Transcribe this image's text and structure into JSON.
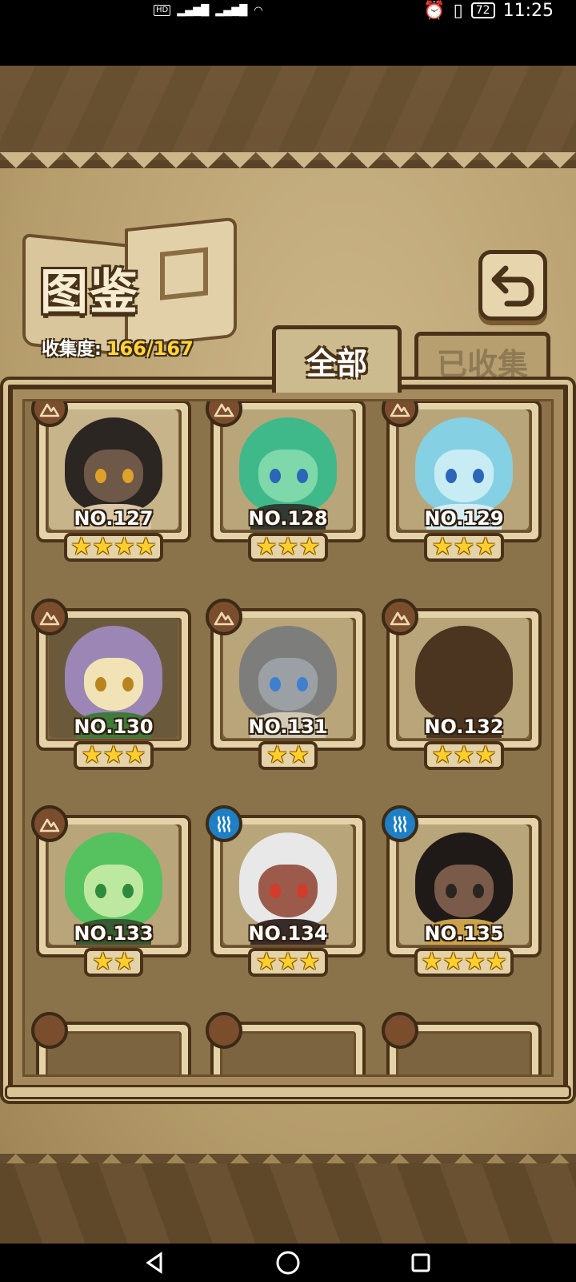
{
  "status_bar": {
    "left_indicators": "HD 2  4G  4G",
    "battery": "72",
    "time": "11:25"
  },
  "header": {
    "title": "图鉴",
    "collection_label": "收集度:",
    "collection_value": "166/167"
  },
  "tabs": [
    {
      "label": "全部",
      "selected": true
    },
    {
      "label": "已收集",
      "selected": false
    }
  ],
  "cards": [
    {
      "number": "NO.127",
      "stars": "★★★★",
      "element": "earth",
      "hair": "#2b2622",
      "skin": "#6e5847",
      "eye": "#e0a12a",
      "cloth": "#d9c7a7",
      "bg": "#c8b48a"
    },
    {
      "number": "NO.128",
      "stars": "★★★",
      "element": "earth",
      "hair": "#3fb98a",
      "skin": "#7fd8a9",
      "eye": "#2b66b8",
      "cloth": "#2f3b33",
      "bg": "#b9a57a"
    },
    {
      "number": "NO.129",
      "stars": "★★★",
      "element": "earth",
      "hair": "#86d0e3",
      "skin": "#c8ecf3",
      "eye": "#2b66b8",
      "cloth": "#d5edf2",
      "bg": "#b9a57a"
    },
    {
      "number": "NO.130",
      "stars": "★★★",
      "element": "earth",
      "hair": "#9b86b5",
      "skin": "#f1e3b6",
      "eye": "#b9841f",
      "cloth": "#3e7a3a",
      "bg": "#6a5a3b"
    },
    {
      "number": "NO.131",
      "stars": "★★",
      "element": "earth",
      "hair": "#7d7e7c",
      "skin": "#9aa0a4",
      "eye": "#3f7fd0",
      "cloth": "#cfc9b6",
      "bg": "#b9a57a"
    },
    {
      "number": "NO.132",
      "stars": "★★★",
      "element": "earth",
      "silhouette": true,
      "hair": "#4b3520",
      "skin": "#4b3520",
      "eye": "#4b3520",
      "cloth": "#4b3520",
      "bg": "#b9a57a"
    },
    {
      "number": "NO.133",
      "stars": "★★",
      "element": "earth",
      "hair": "#56c25f",
      "skin": "#bde8a0",
      "eye": "#2e8a3c",
      "cloth": "#365a33",
      "bg": "#b9a57a"
    },
    {
      "number": "NO.134",
      "stars": "★★★",
      "element": "water",
      "hair": "#e8e8e8",
      "skin": "#9b5a4a",
      "eye": "#d23c2b",
      "cloth": "#3a2b2b",
      "bg": "#b9a57a"
    },
    {
      "number": "NO.135",
      "stars": "★★★★",
      "element": "water",
      "hair": "#1f1a18",
      "skin": "#7a5a48",
      "eye": "#2b2522",
      "cloth": "#c9a24a",
      "bg": "#b9a57a"
    }
  ],
  "element_icons": {
    "earth": "mountain-icon",
    "water": "waves-icon"
  },
  "colors": {
    "star": "#ffcf2e",
    "collection_value": "#ffd43a",
    "earth": "#7a4e2c",
    "water": "#1e7fc7"
  }
}
